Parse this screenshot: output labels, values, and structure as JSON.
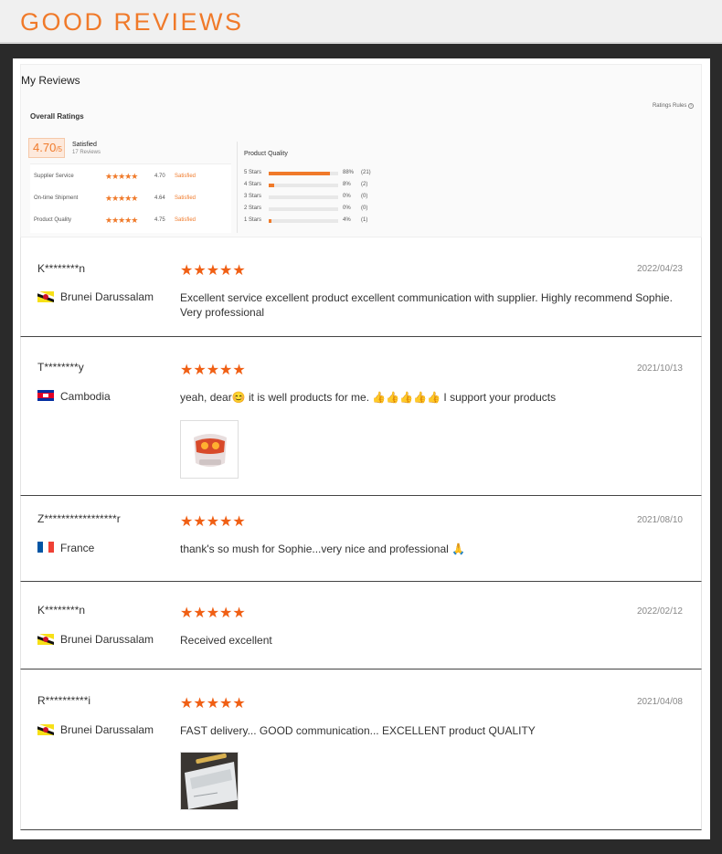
{
  "banner": {
    "title": "GOOD REVIEWS"
  },
  "summary": {
    "heading": "My Reviews",
    "overall_label": "Overall Ratings",
    "rules_label": "Ratings Rules",
    "score": "4.70",
    "score_suffix": "/5",
    "satisfied": "Satisfied",
    "review_count": "17 Reviews",
    "ratings": [
      {
        "label": "Supplier Service",
        "stars": "★★★★★",
        "score": "4.70",
        "status": "Satisfied"
      },
      {
        "label": "On-time Shipment",
        "stars": "★★★★★",
        "score": "4.64",
        "status": "Satisfied"
      },
      {
        "label": "Product Quality",
        "stars": "★★★★★",
        "score": "4.75",
        "status": "Satisfied"
      }
    ],
    "quality_title": "Product Quality",
    "distribution": [
      {
        "label": "5 Stars",
        "percent": 88,
        "percent_text": "88%",
        "count": "(21)"
      },
      {
        "label": "4 Stars",
        "percent": 8,
        "percent_text": "8%",
        "count": "(2)"
      },
      {
        "label": "3 Stars",
        "percent": 0,
        "percent_text": "0%",
        "count": "(0)"
      },
      {
        "label": "2 Stars",
        "percent": 0,
        "percent_text": "0%",
        "count": "(0)"
      },
      {
        "label": "1 Stars",
        "percent": 4,
        "percent_text": "4%",
        "count": "(1)"
      }
    ]
  },
  "reviews": [
    {
      "user": "K********n",
      "stars": "★★★★★",
      "date": "2022/04/23",
      "country": "Brunei Darussalam",
      "flag": "brunei-flag",
      "text": "Excellent service excellent product excellent communication with supplier. Highly recommend Sophie. Very professional"
    },
    {
      "user": "T********y",
      "stars": "★★★★★",
      "date": "2021/10/13",
      "country": "Cambodia",
      "flag": "cambodia-flag",
      "text": "yeah, dear😊 it is well products for me. 👍👍👍👍👍 I support your products"
    },
    {
      "user": "Z*****************r",
      "stars": "★★★★★",
      "date": "2021/08/10",
      "country": "France",
      "flag": "france-flag",
      "text": "thank's so mush for Sophie...very nice and professional 🙏"
    },
    {
      "user": "K********n",
      "stars": "★★★★★",
      "date": "2022/02/12",
      "country": "Brunei Darussalam",
      "flag": "brunei-flag",
      "text": "Received excellent"
    },
    {
      "user": "R**********i",
      "stars": "★★★★★",
      "date": "2021/04/08",
      "country": "Brunei Darussalam",
      "flag": "brunei-flag",
      "text": "FAST delivery... GOOD communication... EXCELLENT product QUALITY"
    }
  ],
  "colors": {
    "accent": "#f07a2a",
    "stars": "#f05f14"
  }
}
